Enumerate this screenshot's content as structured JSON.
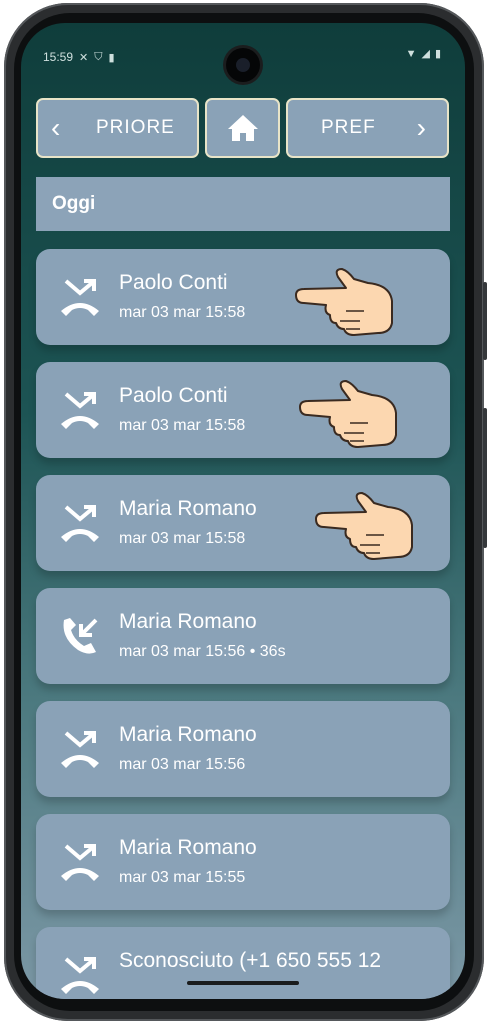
{
  "status_bar": {
    "time": "15:59"
  },
  "nav": {
    "prev_label": "PRIORE",
    "next_label": "PREF"
  },
  "section": {
    "title": "Oggi"
  },
  "calls": [
    {
      "name": "Paolo Conti",
      "time": "mar 03 mar 15:58",
      "type": "missed",
      "pointer": true
    },
    {
      "name": "Paolo Conti",
      "time": "mar 03 mar 15:58",
      "type": "missed",
      "pointer": true
    },
    {
      "name": "Maria Romano",
      "time": "mar 03 mar 15:58",
      "type": "missed",
      "pointer": true
    },
    {
      "name": "Maria Romano",
      "time": "mar 03 mar 15:56 • 36s",
      "type": "incoming",
      "pointer": false
    },
    {
      "name": "Maria Romano",
      "time": "mar 03 mar 15:56",
      "type": "missed",
      "pointer": false
    },
    {
      "name": "Maria Romano",
      "time": "mar 03 mar 15:55",
      "type": "missed",
      "pointer": false
    },
    {
      "name": "Sconosciuto (+1 650 555 12",
      "time": "",
      "type": "missed",
      "pointer": false
    }
  ]
}
